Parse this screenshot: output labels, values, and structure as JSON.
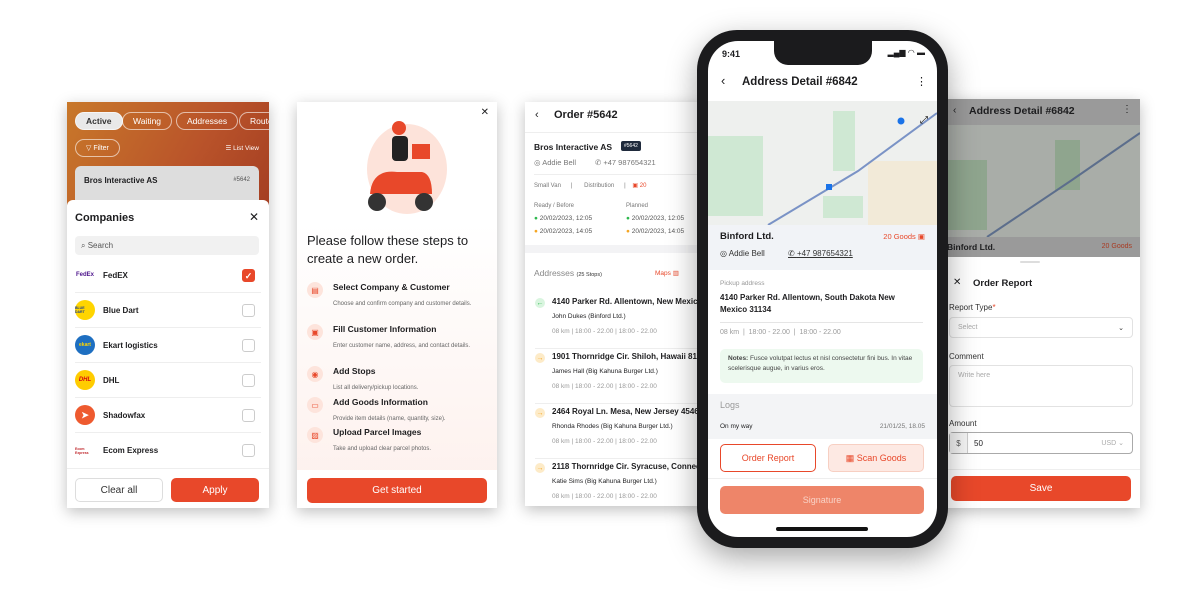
{
  "companies_panel": {
    "tabs": [
      "Active",
      "Waiting",
      "Addresses",
      "Routes"
    ],
    "filter": "Filter",
    "list_view": "List View",
    "card_title": "Bros Interactive AS",
    "card_id": "#5642",
    "title": "Companies",
    "search_placeholder": "Search",
    "items": [
      {
        "name": "FedEX",
        "checked": true,
        "logo": "FedEx"
      },
      {
        "name": "Blue Dart",
        "checked": false,
        "logo": "BLUE DART"
      },
      {
        "name": "Ekart logistics",
        "checked": false,
        "logo": "ekart"
      },
      {
        "name": "DHL",
        "checked": false,
        "logo": "DHL"
      },
      {
        "name": "Shadowfax",
        "checked": false,
        "logo": ""
      },
      {
        "name": "Ecom Express",
        "checked": false,
        "logo": "Ecom Express"
      }
    ],
    "clear": "Clear all",
    "apply": "Apply"
  },
  "steps_panel": {
    "title": "Please follow these steps to create a new order.",
    "steps": [
      {
        "title": "Select Company & Customer",
        "desc": "Choose and confirm company and customer details."
      },
      {
        "title": "Fill Customer Information",
        "desc": "Enter customer name, address, and contact details."
      },
      {
        "title": "Add Stops",
        "desc": "List all delivery/pickup locations."
      },
      {
        "title": "Add Goods Information",
        "desc": "Provide item details (name, quantity, size)."
      },
      {
        "title": "Upload Parcel Images",
        "desc": "Take and upload clear parcel photos."
      }
    ],
    "cta": "Get started"
  },
  "order_panel": {
    "title": "Order #5642",
    "company": "Bros Interactive AS",
    "badge": "#5642",
    "contact": "Addie Bell",
    "phone": "+47 987654321",
    "vehicle": "Small Van",
    "type": "Distribution",
    "goods": "20",
    "ready_label": "Ready / Before",
    "planned_label": "Planned",
    "ready": [
      "20/02/2023, 12:05",
      "20/02/2023, 14:05"
    ],
    "planned": [
      "20/02/2023, 12:05",
      "20/02/2023, 14:05"
    ],
    "addresses_label": "Addresses",
    "stops": "(25 Stops)",
    "maps": "Maps",
    "stop_list": [
      {
        "address": "4140 Parker Rd. Allentown, New Mexico",
        "name": "John Dukes   (Binford Ltd.)",
        "meta": "08 km  |  18:00 - 22.00  |  18:00 - 22.00",
        "kind": "pickup"
      },
      {
        "address": "1901 Thornridge Cir. Shiloh, Hawaii 8100",
        "name": "James Hall   (Big Kahuna Burger Ltd.)",
        "meta": "08 km  |  18:00 - 22.00  |  18:00 - 22.00",
        "kind": "drop"
      },
      {
        "address": "2464 Royal Ln. Mesa, New Jersey 4546",
        "name": "Rhonda Rhodes   (Big Kahuna Burger Ltd.)",
        "meta": "08 km  |  18:00 - 22.00  |  18:00 - 22.00",
        "kind": "drop"
      },
      {
        "address": "2118 Thornridge Cir. Syracuse, Connect",
        "name": "Katie Sims   (Big Kahuna Burger Ltd.)",
        "meta": "08 km  |  18:00 - 22.00  |  18:00 - 22.00",
        "kind": "drop"
      }
    ]
  },
  "phone": {
    "time": "9:41",
    "title": "Address Detail  #6842",
    "company": "Binford Ltd.",
    "goods": "20 Goods",
    "contact": "Addie Bell",
    "phone": "+47 987654321",
    "pickup_label": "Pickup address",
    "pickup_address": "4140 Parker Rd. Allentown, South Dakota New Mexico 31134",
    "meta": "08 km  |  18:00 - 22.00  |  18:00 - 22.00",
    "notes_label": "Notes:",
    "notes": "Fusce volutpat lectus et nisl consectetur fini bus. In vitae scelerisque augue, in varius eros.",
    "logs_label": "Logs",
    "log_event": "On my way",
    "log_time": "21/01/25, 18.05",
    "order_report": "Order Report",
    "scan_goods": "Scan Goods",
    "signature": "Signature"
  },
  "report_panel": {
    "title": "Address Detail  #6842",
    "company": "Binford Ltd.",
    "goods": "20 Goods",
    "sheet_title": "Order Report",
    "report_type_label": "Report Type",
    "required": "*",
    "select_placeholder": "Select",
    "comment_label": "Comment",
    "comment_placeholder": "Write here",
    "amount_label": "Amount",
    "currency_symbol": "$",
    "amount": "50",
    "currency": "USD",
    "save": "Save"
  },
  "colors": {
    "accent": "#e8482a",
    "pickup": "#2db84d",
    "drop": "#f5a623"
  }
}
